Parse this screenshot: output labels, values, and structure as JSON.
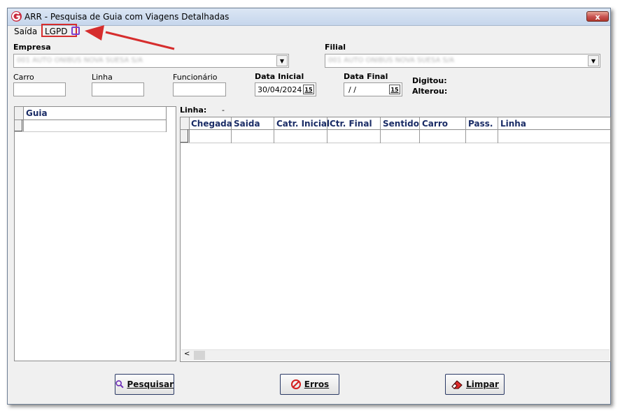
{
  "window": {
    "title": "ARR - Pesquisa de Guia com Viagens Detalhadas",
    "close_glyph": "x"
  },
  "menu": {
    "saida": "Saída",
    "lgpd": "LGPD"
  },
  "fields": {
    "empresa": {
      "label": "Empresa",
      "value": "001 AUTO ONIBUS NOVA SUESA S/A"
    },
    "filial": {
      "label": "Filial",
      "value": "001 AUTO ONIBUS NOVA SUESA S/A"
    },
    "carro": {
      "label": "Carro",
      "value": ""
    },
    "linha": {
      "label": "Linha",
      "value": ""
    },
    "funcionario": {
      "label": "Funcionário",
      "value": ""
    },
    "data_inicial": {
      "label": "Data Inicial",
      "value": "30/04/2024",
      "btn": "15"
    },
    "data_final": {
      "label": "Data Final",
      "value": " / /",
      "btn": "15"
    },
    "digitou": "Digitou:",
    "alterou": "Alterou:"
  },
  "left_grid": {
    "header": "Guia"
  },
  "right_grid": {
    "linha_label": "Linha:",
    "linha_value": "-",
    "columns": [
      "Chegada",
      "Saida",
      "Catr. Inicial",
      "Ctr. Final",
      "Sentido",
      "Carro",
      "Pass.",
      "Linha"
    ]
  },
  "buttons": {
    "pesquisar": "Pesquisar",
    "erros": "Erros",
    "limpar": "Limpar"
  },
  "icons": {
    "app": "app-logo-icon",
    "search": "magnifier-icon",
    "errors": "no-entry-icon",
    "clear": "eraser-icon"
  },
  "colors": {
    "title_bg": "#c6d6ec",
    "header_text": "#1a2c66",
    "highlight": "#d62d2d",
    "close_bg": "#c75050"
  }
}
